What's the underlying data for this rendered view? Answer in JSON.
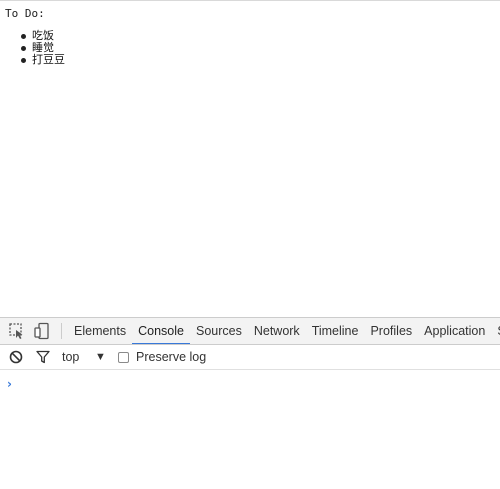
{
  "page": {
    "heading": "To Do:",
    "items": [
      {
        "label": "吃饭"
      },
      {
        "label": "睡觉"
      },
      {
        "label": "打豆豆"
      }
    ]
  },
  "devtools": {
    "tabs": [
      {
        "label": "Elements"
      },
      {
        "label": "Console",
        "active": true
      },
      {
        "label": "Sources"
      },
      {
        "label": "Network"
      },
      {
        "label": "Timeline"
      },
      {
        "label": "Profiles"
      },
      {
        "label": "Application"
      },
      {
        "label": "Se"
      }
    ],
    "context_value": "top",
    "preserve_log_label": "Preserve log",
    "prompt_symbol": "›",
    "accent_color": "#3879d9"
  }
}
